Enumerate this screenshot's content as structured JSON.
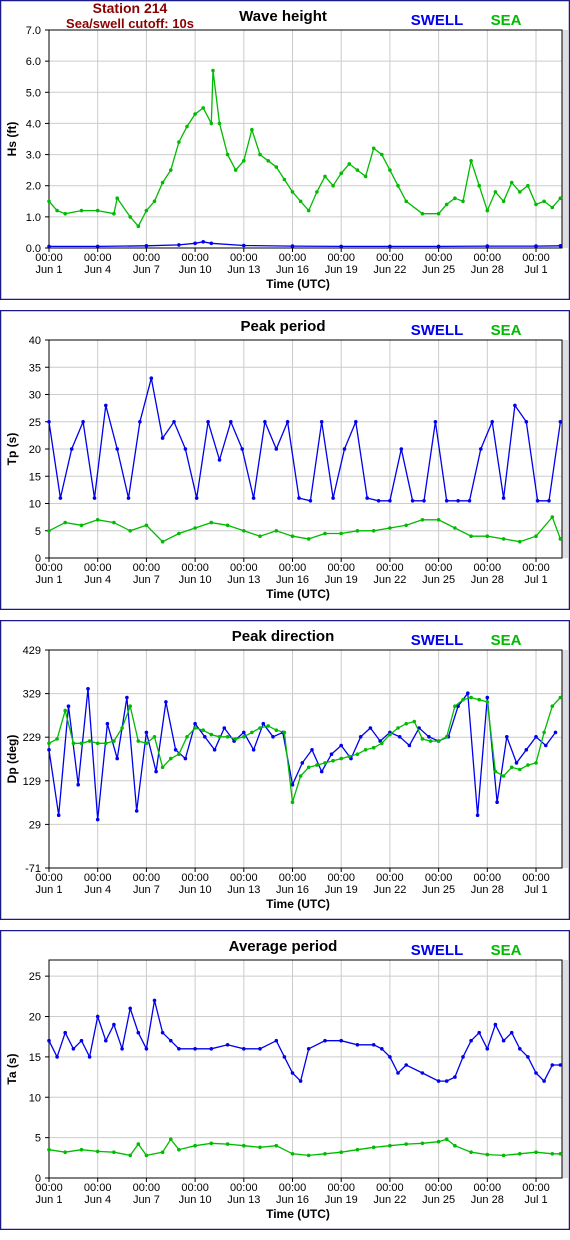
{
  "station_title": "Station 214",
  "cutoff_label": "Sea/swell cutoff: 10s",
  "legend": {
    "swell_label": "SWELL",
    "sea_label": "SEA",
    "swell_color": "#0000ee",
    "sea_color": "#00bb00"
  },
  "colors": {
    "border": "#1a1a8c",
    "plot_bg": "#ffffff",
    "side_bg": "#dddddd",
    "grid": "#cccccc"
  },
  "x_axis": {
    "label": "Time (UTC)",
    "tick_time": "00:00",
    "ticks": [
      "Jun 1",
      "Jun 4",
      "Jun 7",
      "Jun 10",
      "Jun 13",
      "Jun 16",
      "Jun 19",
      "Jun 22",
      "Jun 25",
      "Jun 28",
      "Jul 1"
    ],
    "tick_days": [
      0,
      3,
      6,
      9,
      12,
      15,
      18,
      21,
      24,
      27,
      30
    ],
    "xlim_days": [
      0,
      31.6
    ]
  },
  "chart_data": [
    {
      "type": "line",
      "title": "Wave height",
      "xlabel": "Time (UTC)",
      "ylabel": "Hs (ft)",
      "ylim": [
        0,
        7
      ],
      "yticks": [
        "0.0",
        "1.0",
        "2.0",
        "3.0",
        "4.0",
        "5.0",
        "6.0",
        "7.0"
      ],
      "ytick_values": [
        0,
        1,
        2,
        3,
        4,
        5,
        6,
        7
      ],
      "grid": true,
      "legend_position": "top-right",
      "x_units": "days since Jun 1 00:00",
      "series": [
        {
          "name": "SWELL",
          "x": [
            0,
            3,
            6,
            8,
            9,
            9.5,
            10,
            12,
            15,
            18,
            21,
            24,
            27,
            30,
            31.5
          ],
          "values": [
            0.05,
            0.05,
            0.07,
            0.1,
            0.15,
            0.2,
            0.15,
            0.08,
            0.06,
            0.05,
            0.05,
            0.05,
            0.06,
            0.06,
            0.07
          ]
        },
        {
          "name": "SEA",
          "x": [
            0,
            0.5,
            1,
            2,
            3,
            4,
            4.2,
            5,
            5.5,
            6,
            6.5,
            7,
            7.5,
            8,
            8.5,
            9,
            9.5,
            10,
            10.1,
            10.5,
            11,
            11.5,
            12,
            12.5,
            13,
            13.5,
            14,
            14.5,
            15,
            15.5,
            16,
            16.5,
            17,
            17.5,
            18,
            18.5,
            19,
            19.5,
            20,
            20.5,
            21,
            21.5,
            22,
            23,
            24,
            24.5,
            25,
            25.5,
            26,
            26.5,
            27,
            27.5,
            28,
            28.5,
            29,
            29.5,
            30,
            30.5,
            31,
            31.5
          ],
          "values": [
            1.5,
            1.2,
            1.1,
            1.2,
            1.2,
            1.1,
            1.6,
            1.0,
            0.7,
            1.2,
            1.5,
            2.1,
            2.5,
            3.4,
            3.9,
            4.3,
            4.5,
            4.0,
            5.7,
            4.0,
            3.0,
            2.5,
            2.8,
            3.8,
            3.0,
            2.8,
            2.6,
            2.2,
            1.8,
            1.5,
            1.2,
            1.8,
            2.3,
            2.0,
            2.4,
            2.7,
            2.5,
            2.3,
            3.2,
            3.0,
            2.5,
            2.0,
            1.5,
            1.1,
            1.1,
            1.4,
            1.6,
            1.5,
            2.8,
            2.0,
            1.2,
            1.8,
            1.5,
            2.1,
            1.8,
            2.0,
            1.4,
            1.5,
            1.3,
            1.6
          ]
        }
      ]
    },
    {
      "type": "line",
      "title": "Peak period",
      "xlabel": "Time (UTC)",
      "ylabel": "Tp (s)",
      "ylim": [
        0,
        40
      ],
      "yticks": [
        "0",
        "5",
        "10",
        "15",
        "20",
        "25",
        "30",
        "35",
        "40"
      ],
      "ytick_values": [
        0,
        5,
        10,
        15,
        20,
        25,
        30,
        35,
        40
      ],
      "grid": true,
      "legend_position": "top-right",
      "x_units": "days since Jun 1 00:00",
      "series": [
        {
          "name": "SWELL",
          "x": [
            0,
            0.7,
            1.4,
            2.1,
            2.8,
            3.5,
            4.2,
            4.9,
            5.6,
            6.3,
            7,
            7.7,
            8.4,
            9.1,
            9.8,
            10.5,
            11.2,
            11.9,
            12.6,
            13.3,
            14,
            14.7,
            15.4,
            16.1,
            16.8,
            17.5,
            18.2,
            18.9,
            19.6,
            20.3,
            21,
            21.7,
            22.4,
            23.1,
            23.8,
            24.5,
            25.2,
            25.9,
            26.6,
            27.3,
            28,
            28.7,
            29.4,
            30.1,
            30.8,
            31.5
          ],
          "values": [
            25,
            11,
            20,
            25,
            11,
            28,
            20,
            11,
            25,
            33,
            22,
            25,
            20,
            11,
            25,
            18,
            25,
            20,
            11,
            25,
            20,
            25,
            11,
            10.5,
            25,
            11,
            20,
            25,
            11,
            10.5,
            10.5,
            20,
            10.5,
            10.5,
            25,
            10.5,
            10.5,
            10.5,
            20,
            25,
            11,
            28,
            25,
            10.5,
            10.5,
            25
          ]
        },
        {
          "name": "SEA",
          "x": [
            0,
            1,
            2,
            3,
            4,
            5,
            6,
            7,
            8,
            9,
            10,
            11,
            12,
            13,
            14,
            15,
            16,
            17,
            18,
            19,
            20,
            21,
            22,
            23,
            24,
            25,
            26,
            27,
            28,
            29,
            30,
            31,
            31.5
          ],
          "values": [
            5,
            6.5,
            6,
            7,
            6.5,
            5,
            6,
            3,
            4.5,
            5.5,
            6.5,
            6,
            5,
            4,
            5,
            4,
            3.5,
            4.5,
            4.5,
            5,
            5,
            5.5,
            6,
            7,
            7,
            5.5,
            4,
            4,
            3.5,
            3,
            4,
            7.5,
            3.5
          ]
        }
      ]
    },
    {
      "type": "line",
      "title": "Peak direction",
      "xlabel": "Time (UTC)",
      "ylabel": "Dp (deg)",
      "ylim": [
        -71,
        429
      ],
      "yticks": [
        "-71",
        "29",
        "129",
        "229",
        "329",
        "429"
      ],
      "ytick_values": [
        -71,
        29,
        129,
        229,
        329,
        429
      ],
      "grid": true,
      "legend_position": "top-right",
      "x_units": "days since Jun 1 00:00",
      "series": [
        {
          "name": "SWELL",
          "x": [
            0,
            0.6,
            1.2,
            1.8,
            2.4,
            3,
            3.6,
            4.2,
            4.8,
            5.4,
            6,
            6.6,
            7.2,
            7.8,
            8.4,
            9,
            9.6,
            10.2,
            10.8,
            11.4,
            12,
            12.6,
            13.2,
            13.8,
            14.4,
            15,
            15.6,
            16.2,
            16.8,
            17.4,
            18,
            18.6,
            19.2,
            19.8,
            20.4,
            21,
            21.6,
            22.2,
            22.8,
            23.4,
            24,
            24.6,
            25.2,
            25.8,
            26.4,
            27,
            27.6,
            28.2,
            28.8,
            29.4,
            30,
            30.6,
            31.2
          ],
          "values": [
            200,
            50,
            300,
            120,
            340,
            40,
            260,
            180,
            320,
            60,
            240,
            150,
            310,
            200,
            180,
            260,
            230,
            200,
            250,
            220,
            240,
            200,
            260,
            230,
            240,
            120,
            170,
            200,
            150,
            190,
            210,
            180,
            230,
            250,
            220,
            240,
            230,
            210,
            250,
            230,
            220,
            230,
            300,
            330,
            50,
            320,
            80,
            230,
            170,
            200,
            230,
            210,
            240
          ]
        },
        {
          "name": "SEA",
          "x": [
            0,
            0.5,
            1,
            1.5,
            2,
            2.5,
            3,
            3.5,
            4,
            4.5,
            5,
            5.5,
            6,
            6.5,
            7,
            7.5,
            8,
            8.5,
            9,
            9.5,
            10,
            10.5,
            11,
            11.5,
            12,
            12.5,
            13,
            13.5,
            14,
            14.5,
            15,
            15.5,
            16,
            16.5,
            17,
            17.5,
            18,
            18.5,
            19,
            19.5,
            20,
            20.5,
            21,
            21.5,
            22,
            22.5,
            23,
            23.5,
            24,
            24.5,
            25,
            25.5,
            26,
            26.5,
            27,
            27.5,
            28,
            28.5,
            29,
            29.5,
            30,
            30.5,
            31,
            31.5
          ],
          "values": [
            215,
            225,
            290,
            215,
            215,
            220,
            215,
            215,
            220,
            250,
            300,
            220,
            215,
            230,
            160,
            180,
            190,
            230,
            250,
            245,
            235,
            230,
            230,
            225,
            230,
            240,
            250,
            255,
            245,
            240,
            80,
            140,
            160,
            165,
            170,
            175,
            180,
            185,
            190,
            200,
            205,
            215,
            235,
            250,
            260,
            265,
            225,
            220,
            220,
            230,
            300,
            315,
            320,
            315,
            310,
            150,
            140,
            160,
            155,
            165,
            170,
            240,
            300,
            320
          ]
        }
      ]
    },
    {
      "type": "line",
      "title": "Average period",
      "xlabel": "Time (UTC)",
      "ylabel": "Ta (s)",
      "ylim": [
        0,
        27
      ],
      "yticks": [
        "0",
        "5",
        "10",
        "15",
        "20",
        "25"
      ],
      "ytick_values": [
        0,
        5,
        10,
        15,
        20,
        25
      ],
      "grid": true,
      "legend_position": "top-right",
      "x_units": "days since Jun 1 00:00",
      "series": [
        {
          "name": "SWELL",
          "x": [
            0,
            0.5,
            1,
            1.5,
            2,
            2.5,
            3,
            3.5,
            4,
            4.5,
            5,
            5.5,
            6,
            6.5,
            7,
            7.5,
            8,
            9,
            10,
            11,
            12,
            13,
            14,
            14.5,
            15,
            15.5,
            16,
            17,
            18,
            19,
            20,
            20.5,
            21,
            21.5,
            22,
            23,
            24,
            24.5,
            25,
            25.5,
            26,
            26.5,
            27,
            27.5,
            28,
            28.5,
            29,
            29.5,
            30,
            30.5,
            31,
            31.5
          ],
          "values": [
            17,
            15,
            18,
            16,
            17,
            15,
            20,
            17,
            19,
            16,
            21,
            18,
            16,
            22,
            18,
            17,
            16,
            16,
            16,
            16.5,
            16,
            16,
            17,
            15,
            13,
            12,
            16,
            17,
            17,
            16.5,
            16.5,
            16,
            15,
            13,
            14,
            13,
            12,
            12,
            12.5,
            15,
            17,
            18,
            16,
            19,
            17,
            18,
            16,
            15,
            13,
            12,
            14,
            14
          ]
        },
        {
          "name": "SEA",
          "x": [
            0,
            1,
            2,
            3,
            4,
            5,
            5.5,
            6,
            7,
            7.5,
            8,
            9,
            10,
            11,
            12,
            13,
            14,
            15,
            16,
            17,
            18,
            19,
            20,
            21,
            22,
            23,
            24,
            24.5,
            25,
            26,
            27,
            28,
            29,
            30,
            31,
            31.5
          ],
          "values": [
            3.5,
            3.2,
            3.5,
            3.3,
            3.2,
            2.8,
            4.2,
            2.8,
            3.2,
            4.8,
            3.5,
            4,
            4.3,
            4.2,
            4,
            3.8,
            4,
            3,
            2.8,
            3,
            3.2,
            3.5,
            3.8,
            4,
            4.2,
            4.3,
            4.5,
            4.8,
            4,
            3.2,
            2.9,
            2.8,
            3,
            3.2,
            3,
            3
          ]
        }
      ]
    }
  ]
}
